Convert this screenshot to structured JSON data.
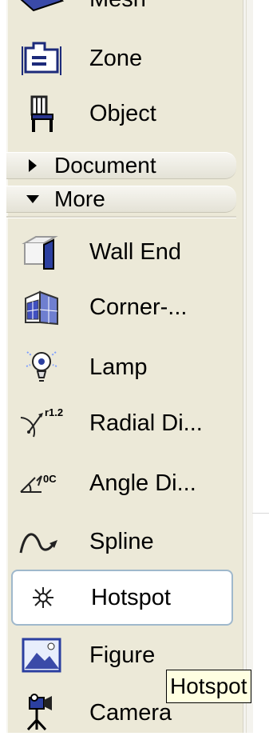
{
  "tools_top": [
    {
      "label": "Mesh",
      "icon": "mesh-icon"
    },
    {
      "label": "Zone",
      "icon": "zone-icon"
    },
    {
      "label": "Object",
      "icon": "object-icon"
    }
  ],
  "sections": {
    "document": {
      "label": "Document",
      "state": "collapsed"
    },
    "more": {
      "label": "More",
      "state": "expanded"
    }
  },
  "tools_more": [
    {
      "label": "Wall End",
      "icon": "wall-end-icon"
    },
    {
      "label": "Corner-...",
      "icon": "corner-window-icon"
    },
    {
      "label": "Lamp",
      "icon": "lamp-icon"
    },
    {
      "label": "Radial Di...",
      "icon": "radial-dimension-icon"
    },
    {
      "label": "Angle Di...",
      "icon": "angle-dimension-icon"
    },
    {
      "label": "Spline",
      "icon": "spline-icon"
    },
    {
      "label": "Hotspot",
      "icon": "hotspot-icon",
      "selected": true
    },
    {
      "label": "Figure",
      "icon": "figure-icon"
    },
    {
      "label": "Camera",
      "icon": "camera-icon"
    }
  ],
  "tooltip": {
    "text": "Hotspot"
  },
  "colors": {
    "panel": "#ece9d8",
    "selected_border": "#9fb8cc",
    "tooltip_bg": "#ffffe1"
  }
}
